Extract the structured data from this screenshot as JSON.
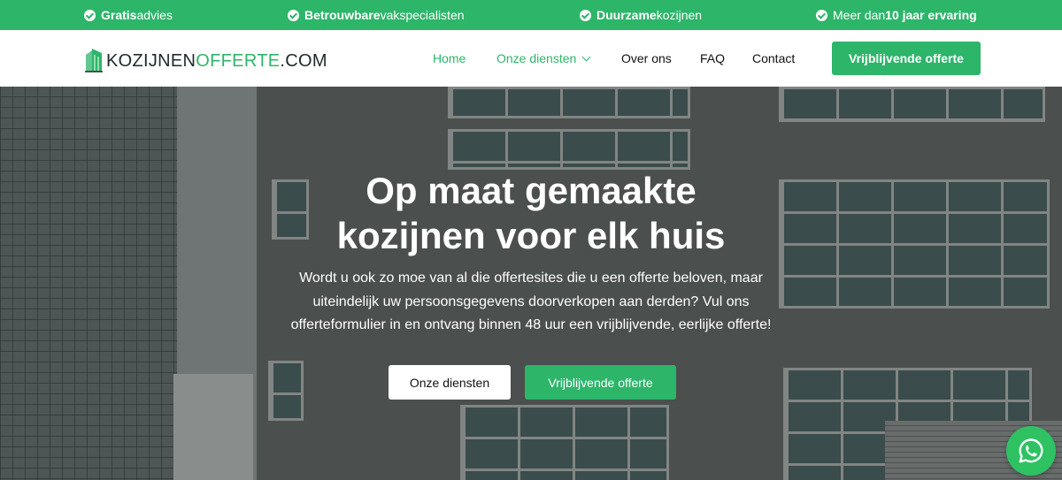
{
  "topbar": {
    "items": [
      {
        "bold": "Gratis",
        "text": " advies"
      },
      {
        "bold": "Betrouwbare",
        "text": " vakspecialisten"
      },
      {
        "bold": "Duurzame",
        "text": " kozijnen"
      },
      {
        "pre": "Meer dan ",
        "bold": "10 jaar ervaring"
      }
    ]
  },
  "header": {
    "logo": {
      "part1": "KOZIJNEN",
      "part2": "OFFERTE",
      "part3": ".COM"
    },
    "nav": [
      {
        "label": "Home",
        "active": true
      },
      {
        "label": "Onze diensten",
        "dropdown": true
      },
      {
        "label": "Over ons"
      },
      {
        "label": "FAQ"
      },
      {
        "label": "Contact"
      }
    ],
    "cta": "Vrijblijvende offerte"
  },
  "hero": {
    "title_line1": "Op maat gemaakte",
    "title_line2": "kozijnen voor elk huis",
    "text_line1": "Wordt u ook zo moe van al die offertesites die u een offerte beloven, maar",
    "text_line2": "uiteindelijk uw persoonsgegevens doorverkopen aan derden? Vul ons",
    "text_line3": "offerteformulier in en ontvang binnen 48 uur een vrijblijvende, eerlijke offerte!",
    "btn_primary": "Onze diensten",
    "btn_secondary": "Vrijblijvende offerte"
  },
  "floating": {
    "icon": "whatsapp-icon"
  },
  "colors": {
    "accent": "#2db56a",
    "white": "#ffffff",
    "text": "#111111"
  }
}
